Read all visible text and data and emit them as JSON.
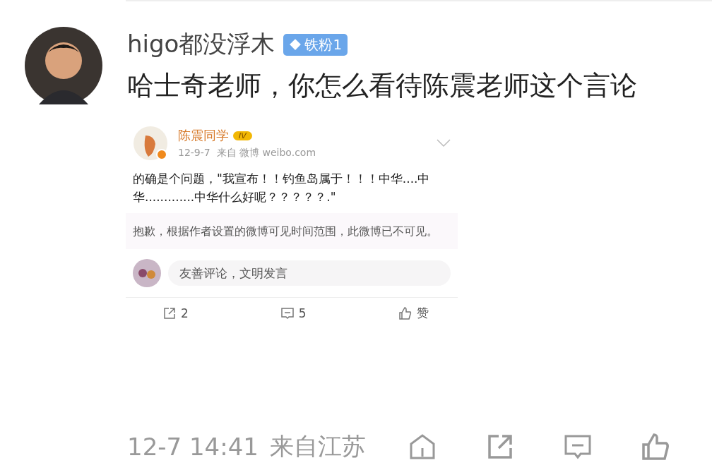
{
  "post": {
    "author": "higo都没浮木",
    "badge": "铁粉1",
    "text": "哈士奇老师，你怎么看待陈震老师这个言论"
  },
  "embedded": {
    "author": "陈震同学",
    "level": "IV",
    "meta": "12-9-7  来自 微博 weibo.com",
    "text": "的确是个问题，\"我宣布！！钓鱼岛属于！！！中华....中华.............中华什么好呢？？？？？.\"",
    "notice": "抱歉，根据作者设置的微博可见时间范围，此微博已不可见。",
    "comment_placeholder": "友善评论，文明发言",
    "reposts": "2",
    "comments": "5",
    "like": "赞"
  },
  "footer": {
    "time": "12-7 14:41",
    "location": "来自江苏"
  }
}
